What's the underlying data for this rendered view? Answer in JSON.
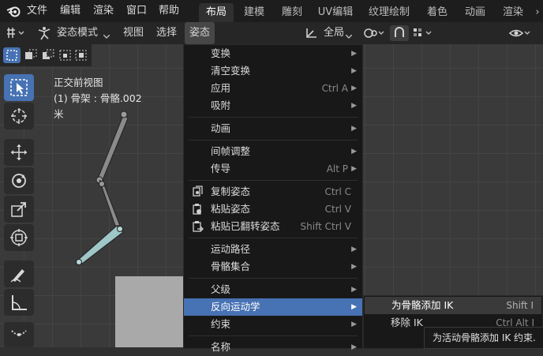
{
  "topbar": {
    "menus": [
      "文件",
      "编辑",
      "渲染",
      "窗口",
      "帮助"
    ],
    "workspaces": [
      "布局",
      "建模",
      "雕刻",
      "UV编辑",
      "纹理绘制",
      "着色",
      "动画",
      "渲染"
    ],
    "active_workspace": "布局"
  },
  "header": {
    "mode": "姿态模式",
    "view": "视图",
    "select": "选择",
    "pose": "姿态",
    "transform_orientation": "全局"
  },
  "viewport": {
    "view_name": "正交前视图",
    "object_info": "(1) 骨架 : 骨骼.002",
    "unit": "米"
  },
  "pose_menu": {
    "items": [
      {
        "label": "变换",
        "shortcut": "",
        "submenu": true
      },
      {
        "label": "清空变换",
        "shortcut": "",
        "submenu": true
      },
      {
        "label": "应用",
        "shortcut": "Ctrl A",
        "submenu": true
      },
      {
        "label": "吸附",
        "shortcut": "",
        "submenu": true
      },
      {
        "label": "动画",
        "shortcut": "",
        "submenu": true
      },
      {
        "label": "间帧调整",
        "shortcut": "",
        "submenu": true
      },
      {
        "label": "传导",
        "shortcut": "Alt P",
        "submenu": true
      },
      {
        "label": "复制姿态",
        "shortcut": "Ctrl C",
        "submenu": false
      },
      {
        "label": "粘贴姿态",
        "shortcut": "Ctrl V",
        "submenu": false
      },
      {
        "label": "粘贴已翻转姿态",
        "shortcut": "Shift Ctrl V",
        "submenu": false
      },
      {
        "label": "运动路径",
        "shortcut": "",
        "submenu": true
      },
      {
        "label": "骨骼集合",
        "shortcut": "",
        "submenu": true
      },
      {
        "label": "父级",
        "shortcut": "",
        "submenu": true
      },
      {
        "label": "反向运动学",
        "shortcut": "",
        "submenu": true
      },
      {
        "label": "约束",
        "shortcut": "",
        "submenu": true
      },
      {
        "label": "名称",
        "shortcut": "",
        "submenu": true
      }
    ]
  },
  "ik_submenu": {
    "items": [
      {
        "label": "为骨骼添加 IK",
        "shortcut": "Shift I"
      },
      {
        "label": "移除 IK",
        "shortcut": "Ctrl Alt I"
      }
    ]
  },
  "tooltip": "为活动骨骼添加 IK 约束."
}
